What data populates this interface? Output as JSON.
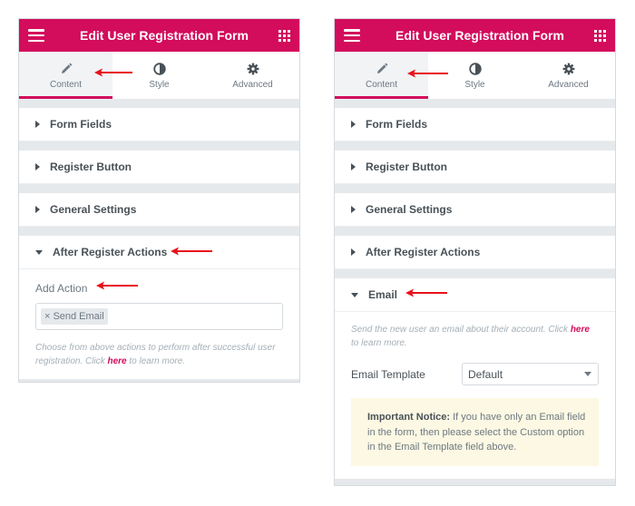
{
  "accent_color": "#d30c5c",
  "arrow_color": "#e8101a",
  "left_panel": {
    "header": {
      "title": "Edit User Registration Form",
      "menu_icon": "hamburger-icon",
      "apps_icon": "grid-icon"
    },
    "tabs": [
      {
        "label": "Content",
        "icon": "pencil-icon",
        "active": true
      },
      {
        "label": "Style",
        "icon": "half-circle-icon",
        "active": false
      },
      {
        "label": "Advanced",
        "icon": "gear-icon",
        "active": false
      }
    ],
    "sections": [
      {
        "label": "Form Fields",
        "open": false
      },
      {
        "label": "Register Button",
        "open": false
      },
      {
        "label": "General Settings",
        "open": false
      },
      {
        "label": "After Register Actions",
        "open": true
      }
    ],
    "add_action": {
      "label": "Add Action",
      "tag_remove": "×",
      "tag": "Send Email",
      "help_pre": "Choose from above actions to perform after successful user registration. Click ",
      "help_link": "here",
      "help_post": " to learn more."
    }
  },
  "right_panel": {
    "header": {
      "title": "Edit User Registration Form",
      "menu_icon": "hamburger-icon",
      "apps_icon": "grid-icon"
    },
    "tabs": [
      {
        "label": "Content",
        "icon": "pencil-icon",
        "active": true
      },
      {
        "label": "Style",
        "icon": "half-circle-icon",
        "active": false
      },
      {
        "label": "Advanced",
        "icon": "gear-icon",
        "active": false
      }
    ],
    "sections": [
      {
        "label": "Form Fields",
        "open": false
      },
      {
        "label": "Register Button",
        "open": false
      },
      {
        "label": "General Settings",
        "open": false
      },
      {
        "label": "After Register Actions",
        "open": false
      },
      {
        "label": "Email",
        "open": true
      }
    ],
    "email": {
      "help_pre": "Send the new user an email about their account. Click ",
      "help_link": "here",
      "help_post": " to learn more.",
      "template_label": "Email Template",
      "template_value": "Default",
      "notice_title": "Important Notice:",
      "notice_text": " If you have only an Email field in the form, then please select the Custom option in the Email Template field above."
    }
  }
}
